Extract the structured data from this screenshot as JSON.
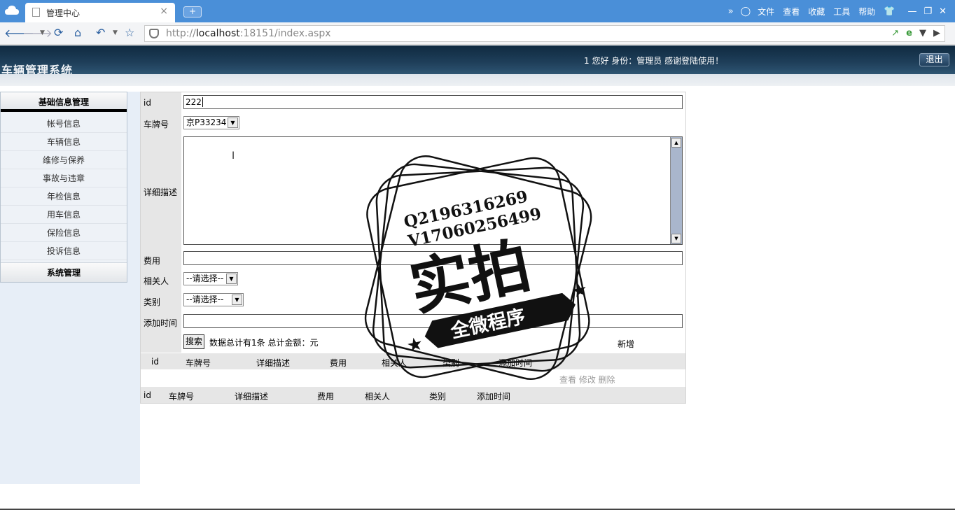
{
  "browser": {
    "tab_title": "管理中心",
    "tab_close": "×",
    "new_tab": "+",
    "url_prefix": "http://",
    "url_host": "localhost",
    "url_rest": ":18151/index.aspx",
    "menu": [
      "文件",
      "查看",
      "收藏",
      "工具",
      "帮助"
    ]
  },
  "header": {
    "title": "车辆管理系统",
    "greeting": "1 您好 身份：管理员 感谢登陆使用！",
    "logout": "退出"
  },
  "sidebar": {
    "group_basic": "基础信息管理",
    "items": [
      "帐号信息",
      "车辆信息",
      "维修与保养",
      "事故与违章",
      "年检信息",
      "用车信息",
      "保险信息",
      "投诉信息"
    ],
    "group_system": "系统管理"
  },
  "form": {
    "id_label": "id",
    "id_value": "222",
    "plate_label": "车牌号",
    "plate_value": "京P33234",
    "desc_label": "详细描述",
    "cost_label": "费用",
    "person_label": "相关人",
    "person_value": "--请选择--",
    "category_label": "类别",
    "category_value": "--请选择--",
    "time_label": "添加时间",
    "search": "搜索",
    "summary": "数据总计有1条 总计金额：元",
    "add": "新增"
  },
  "table": {
    "headers": [
      "id",
      "车牌号",
      "详细描述",
      "费用",
      "相关人",
      "类别",
      "添加时间"
    ],
    "actions": "查看 修改 删除"
  },
  "watermark": {
    "line1": "Q2196316269",
    "line2": "V17060256499",
    "main": "实拍",
    "banner": "全微程序"
  }
}
